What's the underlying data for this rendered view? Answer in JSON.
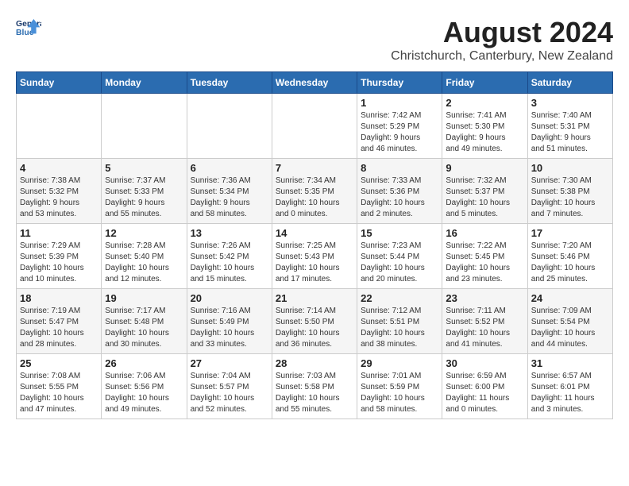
{
  "header": {
    "logo_line1": "General",
    "logo_line2": "Blue",
    "month_year": "August 2024",
    "location": "Christchurch, Canterbury, New Zealand"
  },
  "weekdays": [
    "Sunday",
    "Monday",
    "Tuesday",
    "Wednesday",
    "Thursday",
    "Friday",
    "Saturday"
  ],
  "weeks": [
    [
      {
        "day": "",
        "info": ""
      },
      {
        "day": "",
        "info": ""
      },
      {
        "day": "",
        "info": ""
      },
      {
        "day": "",
        "info": ""
      },
      {
        "day": "1",
        "info": "Sunrise: 7:42 AM\nSunset: 5:29 PM\nDaylight: 9 hours\nand 46 minutes."
      },
      {
        "day": "2",
        "info": "Sunrise: 7:41 AM\nSunset: 5:30 PM\nDaylight: 9 hours\nand 49 minutes."
      },
      {
        "day": "3",
        "info": "Sunrise: 7:40 AM\nSunset: 5:31 PM\nDaylight: 9 hours\nand 51 minutes."
      }
    ],
    [
      {
        "day": "4",
        "info": "Sunrise: 7:38 AM\nSunset: 5:32 PM\nDaylight: 9 hours\nand 53 minutes."
      },
      {
        "day": "5",
        "info": "Sunrise: 7:37 AM\nSunset: 5:33 PM\nDaylight: 9 hours\nand 55 minutes."
      },
      {
        "day": "6",
        "info": "Sunrise: 7:36 AM\nSunset: 5:34 PM\nDaylight: 9 hours\nand 58 minutes."
      },
      {
        "day": "7",
        "info": "Sunrise: 7:34 AM\nSunset: 5:35 PM\nDaylight: 10 hours\nand 0 minutes."
      },
      {
        "day": "8",
        "info": "Sunrise: 7:33 AM\nSunset: 5:36 PM\nDaylight: 10 hours\nand 2 minutes."
      },
      {
        "day": "9",
        "info": "Sunrise: 7:32 AM\nSunset: 5:37 PM\nDaylight: 10 hours\nand 5 minutes."
      },
      {
        "day": "10",
        "info": "Sunrise: 7:30 AM\nSunset: 5:38 PM\nDaylight: 10 hours\nand 7 minutes."
      }
    ],
    [
      {
        "day": "11",
        "info": "Sunrise: 7:29 AM\nSunset: 5:39 PM\nDaylight: 10 hours\nand 10 minutes."
      },
      {
        "day": "12",
        "info": "Sunrise: 7:28 AM\nSunset: 5:40 PM\nDaylight: 10 hours\nand 12 minutes."
      },
      {
        "day": "13",
        "info": "Sunrise: 7:26 AM\nSunset: 5:42 PM\nDaylight: 10 hours\nand 15 minutes."
      },
      {
        "day": "14",
        "info": "Sunrise: 7:25 AM\nSunset: 5:43 PM\nDaylight: 10 hours\nand 17 minutes."
      },
      {
        "day": "15",
        "info": "Sunrise: 7:23 AM\nSunset: 5:44 PM\nDaylight: 10 hours\nand 20 minutes."
      },
      {
        "day": "16",
        "info": "Sunrise: 7:22 AM\nSunset: 5:45 PM\nDaylight: 10 hours\nand 23 minutes."
      },
      {
        "day": "17",
        "info": "Sunrise: 7:20 AM\nSunset: 5:46 PM\nDaylight: 10 hours\nand 25 minutes."
      }
    ],
    [
      {
        "day": "18",
        "info": "Sunrise: 7:19 AM\nSunset: 5:47 PM\nDaylight: 10 hours\nand 28 minutes."
      },
      {
        "day": "19",
        "info": "Sunrise: 7:17 AM\nSunset: 5:48 PM\nDaylight: 10 hours\nand 30 minutes."
      },
      {
        "day": "20",
        "info": "Sunrise: 7:16 AM\nSunset: 5:49 PM\nDaylight: 10 hours\nand 33 minutes."
      },
      {
        "day": "21",
        "info": "Sunrise: 7:14 AM\nSunset: 5:50 PM\nDaylight: 10 hours\nand 36 minutes."
      },
      {
        "day": "22",
        "info": "Sunrise: 7:12 AM\nSunset: 5:51 PM\nDaylight: 10 hours\nand 38 minutes."
      },
      {
        "day": "23",
        "info": "Sunrise: 7:11 AM\nSunset: 5:52 PM\nDaylight: 10 hours\nand 41 minutes."
      },
      {
        "day": "24",
        "info": "Sunrise: 7:09 AM\nSunset: 5:54 PM\nDaylight: 10 hours\nand 44 minutes."
      }
    ],
    [
      {
        "day": "25",
        "info": "Sunrise: 7:08 AM\nSunset: 5:55 PM\nDaylight: 10 hours\nand 47 minutes."
      },
      {
        "day": "26",
        "info": "Sunrise: 7:06 AM\nSunset: 5:56 PM\nDaylight: 10 hours\nand 49 minutes."
      },
      {
        "day": "27",
        "info": "Sunrise: 7:04 AM\nSunset: 5:57 PM\nDaylight: 10 hours\nand 52 minutes."
      },
      {
        "day": "28",
        "info": "Sunrise: 7:03 AM\nSunset: 5:58 PM\nDaylight: 10 hours\nand 55 minutes."
      },
      {
        "day": "29",
        "info": "Sunrise: 7:01 AM\nSunset: 5:59 PM\nDaylight: 10 hours\nand 58 minutes."
      },
      {
        "day": "30",
        "info": "Sunrise: 6:59 AM\nSunset: 6:00 PM\nDaylight: 11 hours\nand 0 minutes."
      },
      {
        "day": "31",
        "info": "Sunrise: 6:57 AM\nSunset: 6:01 PM\nDaylight: 11 hours\nand 3 minutes."
      }
    ]
  ]
}
